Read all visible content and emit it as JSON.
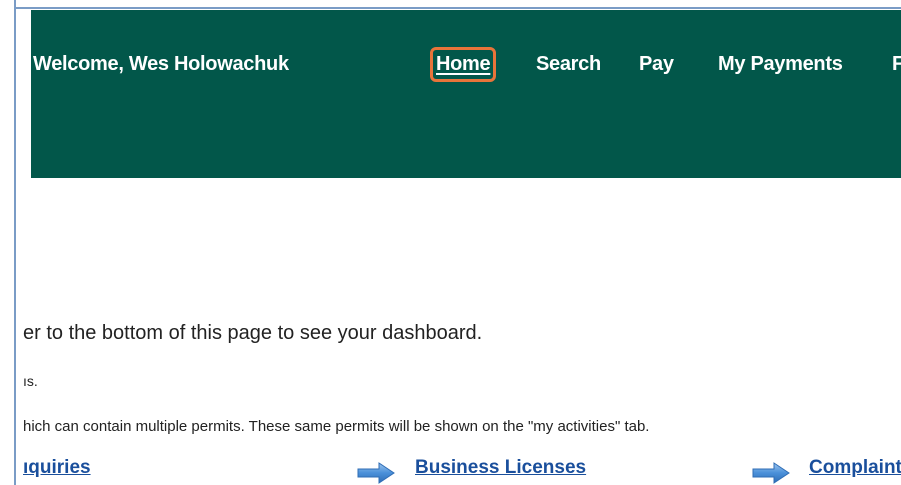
{
  "header": {
    "welcome_text": "Welcome, Wes Holowachuk",
    "nav": {
      "home": "Home",
      "search": "Search",
      "pay": "Pay",
      "my_payments": "My Payments",
      "cut_item": "F"
    }
  },
  "content": {
    "line1": "er to the bottom of this page to see your dashboard.",
    "line2": "ıs.",
    "line3": "hich can contain multiple permits. These same permits will be shown on the \"my activities\" tab."
  },
  "links": {
    "inquiries": "ıquiries",
    "business_licenses": "Business Licenses",
    "complaints": "Complaint"
  },
  "colors": {
    "header_bg": "#02574a",
    "highlight": "#e8743a",
    "link": "#1a4f9c",
    "arrow": "#4a90d9"
  },
  "icons": {
    "arrow": "arrow-right-icon"
  }
}
